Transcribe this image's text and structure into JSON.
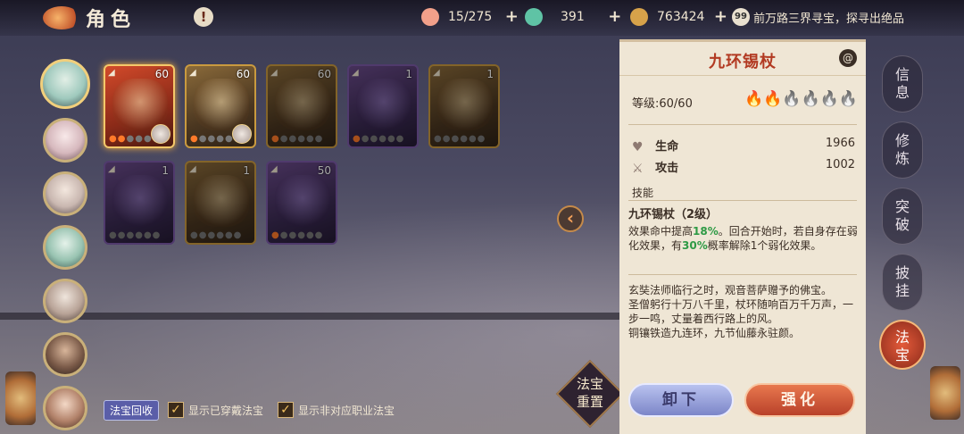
{
  "header": {
    "title": "角色",
    "alert_symbol": "!",
    "resources": [
      {
        "name": "peach-icon",
        "value": "15/275",
        "color": "#f2a08a"
      },
      {
        "name": "jade-icon",
        "value": "391",
        "color": "#5fc3a5"
      },
      {
        "name": "coin-icon",
        "value": "763424",
        "color": "#d7a24a"
      }
    ],
    "plus_symbol": "+",
    "notice_badge": "99",
    "notice_text": "前万路三界寻宝，探寻出绝品"
  },
  "characters": [
    {
      "name": "char-1",
      "selected": true
    },
    {
      "name": "char-2"
    },
    {
      "name": "char-3"
    },
    {
      "name": "char-4"
    },
    {
      "name": "char-5"
    },
    {
      "name": "char-6"
    },
    {
      "name": "char-7"
    }
  ],
  "treasures": [
    {
      "level": "60",
      "quality": "gold",
      "selected": true,
      "flames_lit": 2,
      "flames_total": 6,
      "equipped_owner": true
    },
    {
      "level": "60",
      "quality": "gold",
      "flames_lit": 1,
      "flames_total": 6,
      "equipped_owner": true
    },
    {
      "level": "60",
      "quality": "gold",
      "dim": true,
      "flames_lit": 1,
      "flames_total": 6
    },
    {
      "level": "1",
      "quality": "purple",
      "dim": true,
      "flames_lit": 1,
      "flames_total": 6
    },
    {
      "level": "1",
      "quality": "gold",
      "dim": true,
      "flames_lit": 0,
      "flames_total": 6
    },
    {
      "level": "1",
      "quality": "purple",
      "dim": true,
      "flames_lit": 0,
      "flames_total": 6
    },
    {
      "level": "1",
      "quality": "gold",
      "dim": true,
      "flames_lit": 0,
      "flames_total": 6
    },
    {
      "level": "50",
      "quality": "purple",
      "dim": true,
      "flames_lit": 1,
      "flames_total": 6
    }
  ],
  "bottom": {
    "recycle_label": "法宝回收",
    "show_equipped_label": "显示已穿戴法宝",
    "show_other_class_label": "显示非对应职业法宝",
    "check_symbol": "✓"
  },
  "collapse_symbol": "‹",
  "reset_label": "法宝重置",
  "detail": {
    "name": "九环锡杖",
    "info_symbol": "@",
    "level_label": "等级:60/60",
    "stars_lit": 2,
    "stars_total": 6,
    "stats": [
      {
        "icon": "heart-icon",
        "name": "生命",
        "value": "1966"
      },
      {
        "icon": "sword-icon",
        "name": "攻击",
        "value": "1002"
      }
    ],
    "skill_header": "技能",
    "skill_name": "九环锡杖（2级）",
    "skill_desc_1": "效果命中提高",
    "skill_hit_pct": "18%",
    "skill_desc_2": "。回合开始时，若自身存在弱化效果，有",
    "skill_chance_pct": "30%",
    "skill_desc_3": "概率解除1个弱化效果。",
    "lore": [
      "玄奘法师临行之时，观音菩萨赠予的佛宝。",
      "圣僧躬行十万八千里，杖环随响百万千万声，一步一鸣，丈量着西行路上的风。",
      "铜镶铁造九连环，九节仙藤永驻颜。"
    ],
    "unequip_label": "卸下",
    "upgrade_label": "强化"
  },
  "right_nav": [
    {
      "label": "信息"
    },
    {
      "label": "修炼"
    },
    {
      "label": "突破"
    },
    {
      "label": "披挂"
    },
    {
      "label": "法宝",
      "active": true
    }
  ],
  "colors": {
    "accent_red": "#b23a22",
    "panel_bg": "#efe6d5",
    "green_highlight": "#2e9a45"
  }
}
